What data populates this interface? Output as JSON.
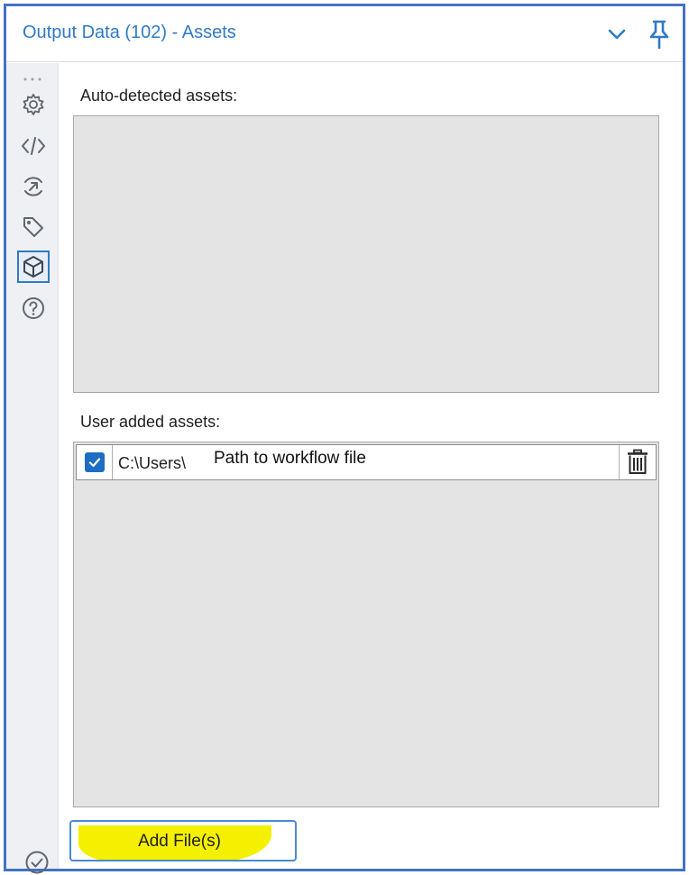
{
  "header": {
    "title": "Output Data (102) - Assets",
    "collapse_icon": "chevron-down-icon",
    "pin_icon": "pin-icon"
  },
  "sidebar": {
    "items": [
      {
        "icon": "gear-icon",
        "active": false
      },
      {
        "icon": "code-icon",
        "active": false
      },
      {
        "icon": "connect-icon",
        "active": false
      },
      {
        "icon": "tag-icon",
        "active": false
      },
      {
        "icon": "box-icon",
        "active": true
      },
      {
        "icon": "help-icon",
        "active": false
      }
    ],
    "status_icon": "check-circle-icon"
  },
  "auto_assets": {
    "label": "Auto-detected assets:",
    "items": []
  },
  "user_assets": {
    "label": "User added assets:",
    "items": [
      {
        "checked": true,
        "path": "C:\\Users\\",
        "note": "Path to workflow file"
      }
    ]
  },
  "add_button": {
    "label": "Add File(s)"
  },
  "colors": {
    "accent": "#2f7ac6",
    "frame": "#4472c4",
    "highlight": "#f4f000",
    "panel": "#e4e4e4"
  }
}
